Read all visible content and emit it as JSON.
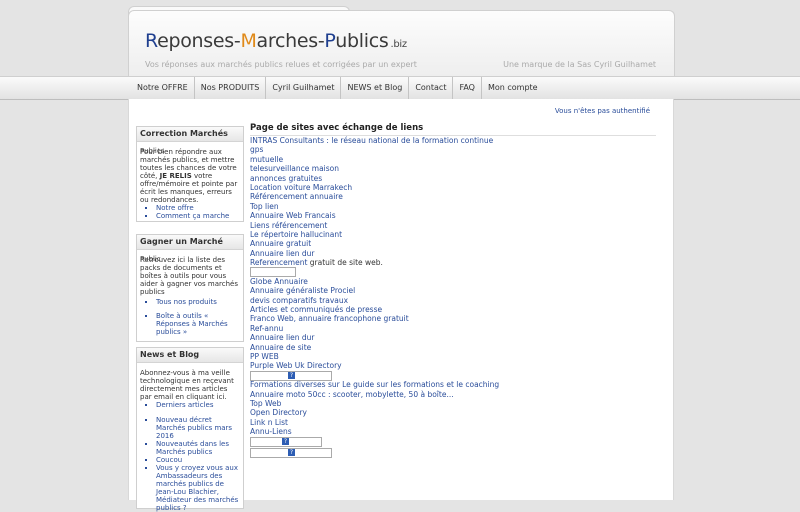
{
  "header": {
    "logo_r": "R",
    "logo_1": "eponses-",
    "logo_m": "M",
    "logo_2": "arches-",
    "logo_p": "P",
    "logo_3": "ublics",
    "logo_tld": ".biz",
    "tagline": "Vos réponses aux marchés publics relues et corrigées par un expert",
    "brandline": "Une marque de la Sas Cyril Guilhamet"
  },
  "nav": [
    "Notre OFFRE",
    "Nos PRODUITS",
    "Cyril Guilhamet",
    "NEWS et Blog",
    "Contact",
    "FAQ",
    "Mon compte"
  ],
  "auth_status": "Vous n'êtes pas authentifié",
  "sidebar": {
    "box1": {
      "title": "Correction Marchés",
      "overlap": "Publics",
      "text_a": "Pour bien répondre aux marchés publics, et mettre toutes les chances de votre côté, ",
      "text_bold": "JE RELIS",
      "text_b": " votre offre/mémoire et pointe par écrit les manques, erreurs ou redondances.",
      "items": [
        "Notre offre",
        "Comment ça marche"
      ]
    },
    "box2": {
      "title": "Gagner un Marché",
      "overlap": "Public",
      "text": "Retrouvez ici la liste des packs de documents et boîtes à outils pour vous aider à gagner vos marchés publics",
      "items": [
        "Tous nos produits",
        "Boîte à outils « Réponses à Marchés publics »"
      ]
    },
    "box3": {
      "title": "News et Blog",
      "text": "Abonnez-vous à ma veille technologique en reçevant directement mes articles par email en cliquant ici.",
      "items": [
        "Derniers articles",
        "Nouveau décret Marchés publics mars 2016",
        "Nouveautés dans les Marchés publics",
        "Coucou",
        "Vous y croyez vous aux Ambassadeurs des marchés publics de Jean-Lou Blachier, Médiateur des marchés publics ?"
      ]
    }
  },
  "main": {
    "title": "Page de sites avec échange de liens",
    "links": [
      "INTRAS Consultants : le réseau national de la formation continue",
      "gps",
      "mutuelle",
      "telesurveillance maison",
      "annonces gratuites",
      "Location voiture Marrakech",
      "Référencement annuaire",
      "Top lien",
      "Annuaire Web Francais",
      "Liens référencement",
      "Le répertoire hallucinant",
      "Annuaire gratuit",
      "Annuaire lien dur",
      "Referencement",
      "Globe Annuaire",
      "Annuaire généraliste Prociel",
      "devis comparatifs travaux",
      "Articles et communiqués de presse",
      "Franco Web, annuaire francophone gratuit",
      "Ref-annu",
      "Annuaire lien dur",
      "Annuaire de site",
      "PP WEB",
      "Purple Web Uk Directory",
      "Formations diverses sur Le guide sur les formations et le coaching",
      "Annuaire moto 50cc : scooter, mobylette, 50 à boîte...",
      "Top Web",
      "Open Directory",
      "Link n List",
      "Annu-Liens"
    ],
    "referencement_suffix": " gratuit de site web.",
    "badge_mark": "?"
  }
}
